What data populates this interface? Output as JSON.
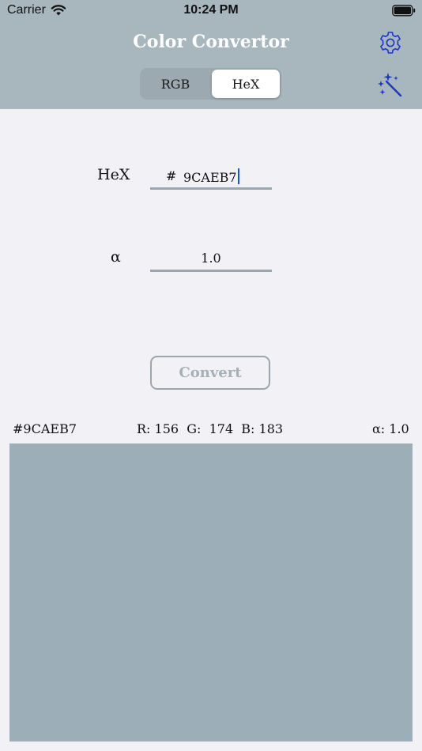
{
  "status_bar": {
    "carrier": "Carrier",
    "time": "10:24 PM"
  },
  "header": {
    "title": "Color Convertor",
    "background": "#a8b6bd",
    "settings_icon": "gear-icon",
    "magic_icon": "magic-wand-icon",
    "icon_color": "#1b35c7"
  },
  "segmented": {
    "options": [
      "RGB",
      "HeX"
    ],
    "selected": "HeX"
  },
  "form": {
    "hex_label": "HeX",
    "hex_prefix": "#",
    "hex_value": "9CAEB7",
    "alpha_label": "α",
    "alpha_value": "1.0"
  },
  "convert_button": "Convert",
  "result": {
    "hex": "#9CAEB7",
    "rgb": "R: 156  G:  174  B: 183",
    "alpha": "α: 1.0",
    "swatch_color": "#9CAEB7"
  }
}
